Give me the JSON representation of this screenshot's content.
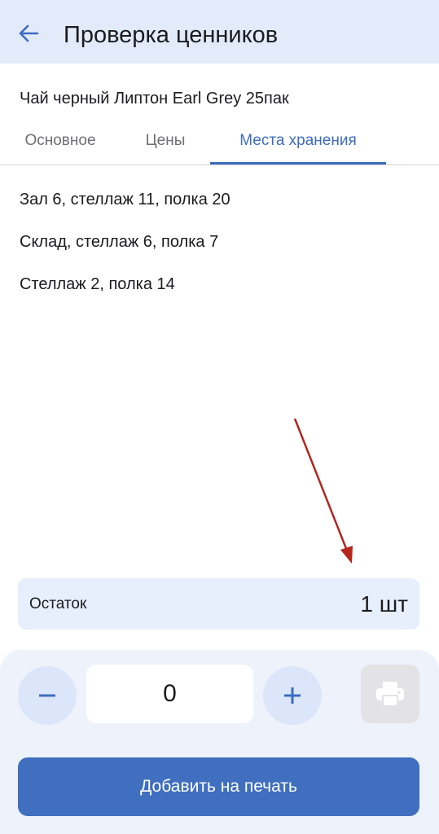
{
  "appbar": {
    "title": "Проверка ценников",
    "back_icon": "arrow-left-icon"
  },
  "product": {
    "name": "Чай черный Липтон Earl Grey 25пак"
  },
  "tabs": [
    {
      "label": "Основное",
      "active": false
    },
    {
      "label": "Цены",
      "active": false
    },
    {
      "label": "Места хранения",
      "active": true
    }
  ],
  "locations": [
    "Зал 6, стеллаж 11, полка 20",
    "Склад, стеллаж 6, полка 7",
    "Стеллаж 2, полка 14"
  ],
  "stock": {
    "label": "Остаток",
    "value": "1 шт"
  },
  "quantity": {
    "value": "0",
    "minus_icon": "minus-icon",
    "plus_icon": "plus-icon"
  },
  "print_icon": "printer-icon",
  "add_button": {
    "label": "Добавить на печать"
  },
  "colors": {
    "accent": "#3d6cbf",
    "appbar_bg": "#e3ebfa",
    "annotation_arrow": "#b3261e"
  }
}
